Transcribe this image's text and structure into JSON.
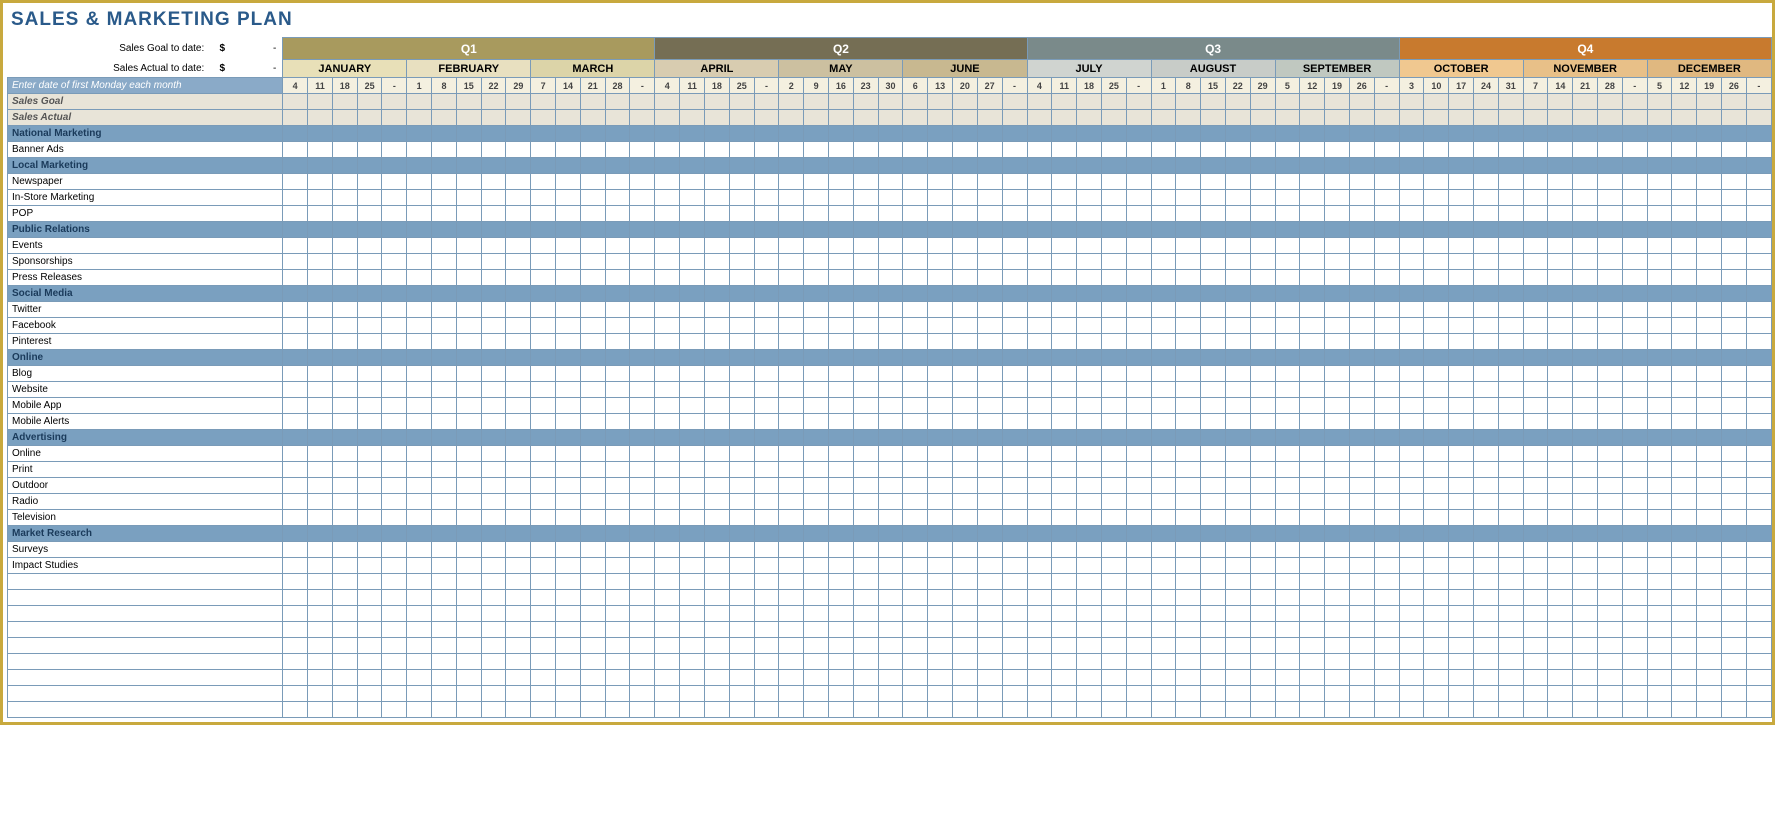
{
  "title": "SALES & MARKETING PLAN",
  "side": {
    "goal_label": "Sales Goal to date:",
    "actual_label": "Sales Actual to date:",
    "currency": "$",
    "dash": "-"
  },
  "quarters": [
    "Q1",
    "Q2",
    "Q3",
    "Q4"
  ],
  "months": [
    "JANUARY",
    "FEBRUARY",
    "MARCH",
    "APRIL",
    "MAY",
    "JUNE",
    "JULY",
    "AUGUST",
    "SEPTEMBER",
    "OCTOBER",
    "NOVEMBER",
    "DECEMBER"
  ],
  "month_spans": [
    5,
    5,
    5,
    5,
    5,
    5,
    5,
    5,
    5,
    5,
    5,
    5
  ],
  "weeks": [
    [
      "4",
      "11",
      "18",
      "25",
      "-"
    ],
    [
      "1",
      "8",
      "15",
      "22",
      "29"
    ],
    [
      "7",
      "14",
      "21",
      "28",
      "-"
    ],
    [
      "4",
      "11",
      "18",
      "25",
      "-"
    ],
    [
      "2",
      "9",
      "16",
      "23",
      "30"
    ],
    [
      "6",
      "13",
      "20",
      "27",
      "-"
    ],
    [
      "4",
      "11",
      "18",
      "25",
      "-"
    ],
    [
      "1",
      "8",
      "15",
      "22",
      "29"
    ],
    [
      "5",
      "12",
      "19",
      "26",
      "-"
    ],
    [
      "3",
      "10",
      "17",
      "24",
      "31"
    ],
    [
      "7",
      "14",
      "21",
      "28",
      "-"
    ],
    [
      "5",
      "12",
      "19",
      "26",
      "-"
    ]
  ],
  "instruction": "Enter date of first Monday each month",
  "rows": [
    {
      "type": "ital",
      "label": "Sales Goal"
    },
    {
      "type": "ital",
      "label": "Sales Actual"
    },
    {
      "type": "cat",
      "label": "National Marketing"
    },
    {
      "type": "item",
      "label": "Banner Ads"
    },
    {
      "type": "cat",
      "label": "Local Marketing"
    },
    {
      "type": "item",
      "label": "Newspaper"
    },
    {
      "type": "item",
      "label": "In-Store Marketing"
    },
    {
      "type": "item",
      "label": "POP"
    },
    {
      "type": "cat",
      "label": "Public Relations"
    },
    {
      "type": "item",
      "label": "Events"
    },
    {
      "type": "item",
      "label": "Sponsorships"
    },
    {
      "type": "item",
      "label": "Press Releases"
    },
    {
      "type": "cat",
      "label": "Social Media"
    },
    {
      "type": "item",
      "label": "Twitter"
    },
    {
      "type": "item",
      "label": "Facebook"
    },
    {
      "type": "item",
      "label": "Pinterest"
    },
    {
      "type": "cat",
      "label": "Online"
    },
    {
      "type": "item",
      "label": "Blog"
    },
    {
      "type": "item",
      "label": "Website"
    },
    {
      "type": "item",
      "label": "Mobile App"
    },
    {
      "type": "item",
      "label": "Mobile Alerts"
    },
    {
      "type": "cat",
      "label": "Advertising"
    },
    {
      "type": "item",
      "label": "Online"
    },
    {
      "type": "item",
      "label": "Print"
    },
    {
      "type": "item",
      "label": "Outdoor"
    },
    {
      "type": "item",
      "label": "Radio"
    },
    {
      "type": "item",
      "label": "Television"
    },
    {
      "type": "cat",
      "label": "Market Research"
    },
    {
      "type": "item",
      "label": "Surveys"
    },
    {
      "type": "item",
      "label": "Impact Studies"
    },
    {
      "type": "empty",
      "label": ""
    },
    {
      "type": "empty",
      "label": ""
    },
    {
      "type": "empty",
      "label": ""
    },
    {
      "type": "empty",
      "label": ""
    },
    {
      "type": "empty",
      "label": ""
    },
    {
      "type": "empty",
      "label": ""
    },
    {
      "type": "empty",
      "label": ""
    },
    {
      "type": "empty",
      "label": ""
    },
    {
      "type": "empty",
      "label": ""
    }
  ]
}
